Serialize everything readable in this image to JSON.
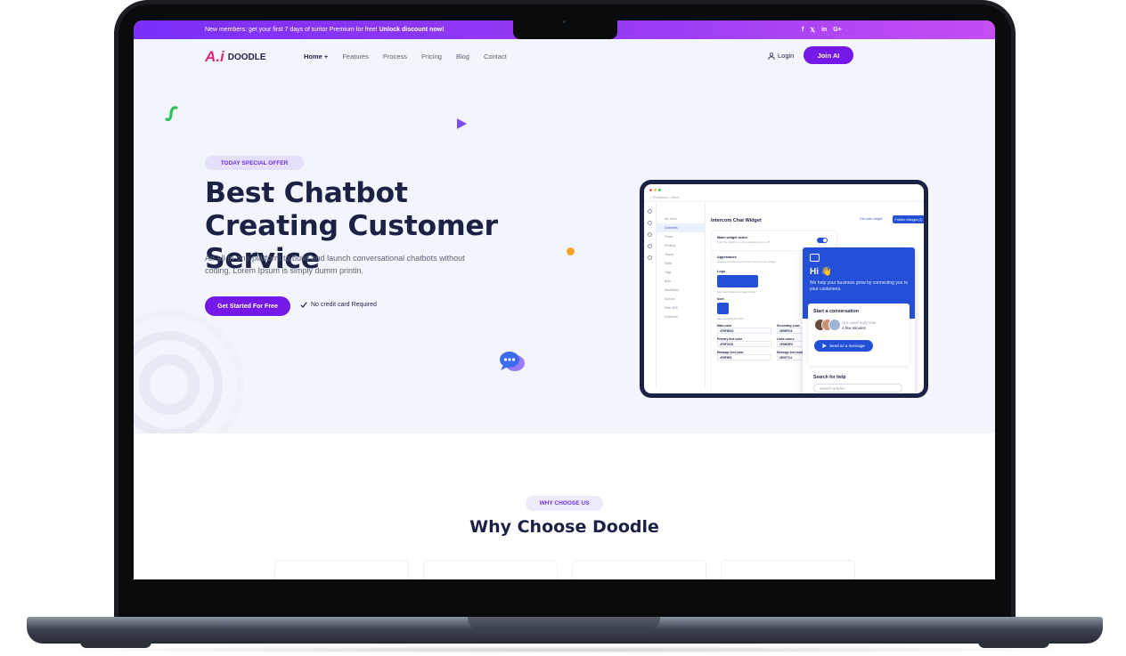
{
  "topbar": {
    "promo_prefix": "New members: get your first 7 days of turitor Premium for free!",
    "promo_link": "Unlock discount now!",
    "social": [
      "f",
      "𝕏",
      "in",
      "G+"
    ]
  },
  "nav": {
    "logo_mark": "A.i",
    "logo_text": "DOODLE",
    "menu": [
      "Home +",
      "Features",
      "Process",
      "Pricing",
      "Blog",
      "Contact"
    ],
    "login": "Login",
    "join": "Join AI"
  },
  "hero": {
    "badge": "TODAY SPECIAL OFFER",
    "title": "Best Chatbot Creating Customer Service",
    "lede": "An all-in-one platform to build and launch conversational chatbots without coding. Lorem Ipsum is simply dumm printin.",
    "cta": "Get Started For Free",
    "no_card": "No credit card Required"
  },
  "app": {
    "crumb": "< Channels / Inbox",
    "menu": [
      "My Inbox",
      "Channels",
      "Flows",
      "Routing",
      "Teams",
      "Skills",
      "Tags",
      "Bots",
      "Workflows",
      "Actions",
      "Web SDK",
      "Channels"
    ],
    "title": "Intercom Chat Widget",
    "btn_secondary": "Get code widget",
    "btn_primary": "Publish changes (2)",
    "widget_active": "Make widget active",
    "widget_active_sub": "Turn the visibility on your website(s) on or off",
    "appearance": "Appearance",
    "appearance_sub": "Change the layout and colors used in your widget",
    "logo": "Logo",
    "logo_sub": "Max width 90px and height 56px",
    "icon": "Icon",
    "icon_sub": "Max width/height 56px",
    "fields": [
      {
        "label": "Main color",
        "value": "#F9F8D02"
      },
      {
        "label": "Secondary color",
        "value": "#E5EFD4"
      },
      {
        "label": "Primary text color",
        "value": "#F9F2226"
      },
      {
        "label": "Links colors",
        "value": "#F9363F9"
      },
      {
        "label": "Message text color",
        "value": "#F9F9F9"
      },
      {
        "label": "Message text bubbles",
        "value": "#E0F7C4"
      }
    ]
  },
  "widget": {
    "hi": "Hi 👋",
    "text": "We help your business grow by connecting you to your customers.",
    "start": "Start a conversation",
    "reply_label": "Our usual reply time",
    "reply_value": "A few minutes",
    "send": "Send us a message",
    "search": "Search for help",
    "search_placeholder": "Search articles"
  },
  "why": {
    "badge": "WHY CHOOSE US",
    "title": "Why Choose Doodle"
  },
  "colors": {
    "brand": "#7419e8",
    "navy": "#1b2245",
    "widget_blue": "#2450d8",
    "accent_orange": "#f7a328",
    "accent_green": "#2ec45a"
  }
}
